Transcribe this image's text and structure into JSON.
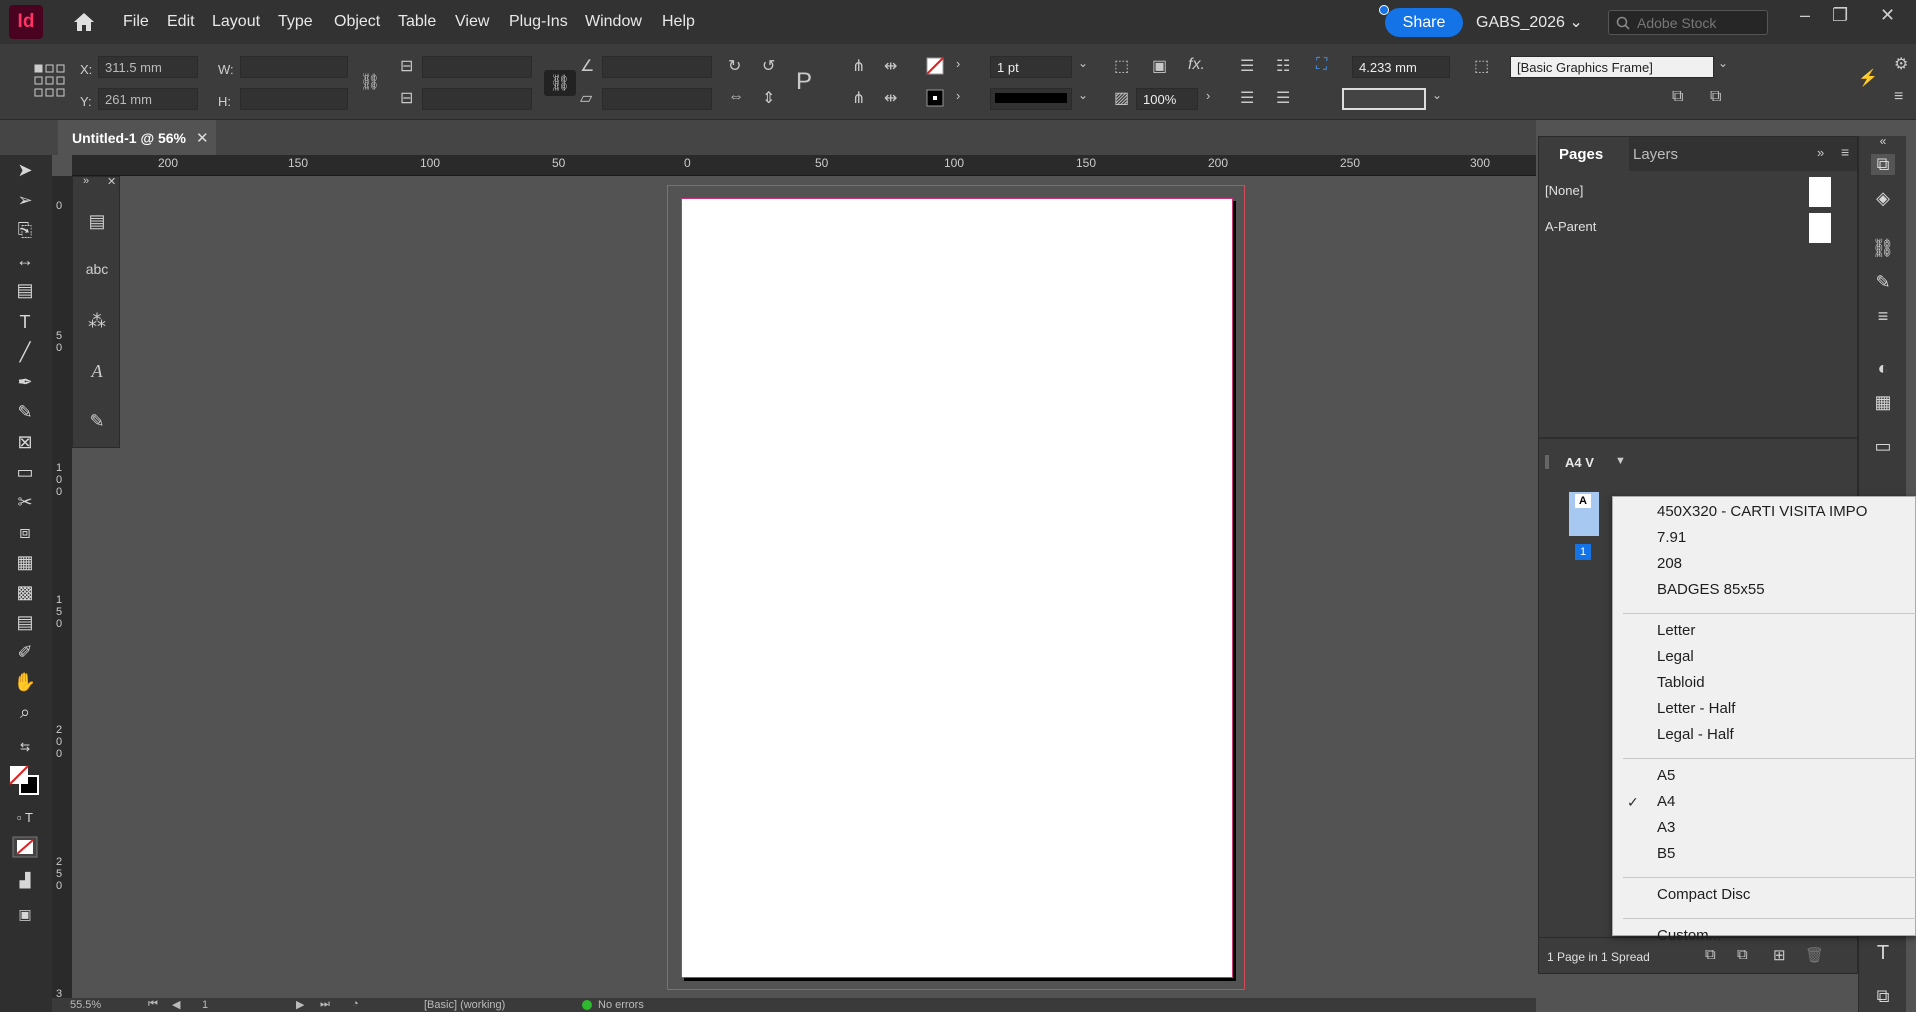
{
  "app": {
    "logo": "Id",
    "workspace": "GABS_2026",
    "share_label": "Share",
    "stock_placeholder": "Adobe Stock"
  },
  "menu": [
    "File",
    "Edit",
    "Layout",
    "Type",
    "Object",
    "Table",
    "View",
    "Plug-Ins",
    "Window",
    "Help"
  ],
  "control": {
    "x_label": "X:",
    "x_value": "311.5 mm",
    "y_label": "Y:",
    "y_value": "261 mm",
    "w_label": "W:",
    "h_label": "H:",
    "stroke_weight": "1 pt",
    "opacity": "100%",
    "spacing": "4.233 mm",
    "object_style": "[Basic Graphics Frame]"
  },
  "document": {
    "tab_title": "Untitled-1 @ 56%"
  },
  "ruler": {
    "h_ticks": [
      "200",
      "150",
      "100",
      "50",
      "0",
      "50",
      "100",
      "150",
      "200",
      "250",
      "300"
    ],
    "v_ticks": [
      "0",
      "5\n0",
      "1\n0\n0",
      "1\n5\n0",
      "2\n0\n0",
      "2\n5\n0",
      "3"
    ]
  },
  "status": {
    "zoom": "55.5%",
    "page": "1",
    "preflight_profile": "[Basic] (working)",
    "errors": "No errors"
  },
  "pages_panel": {
    "tabs": [
      "Pages",
      "Layers"
    ],
    "parents": [
      "[None]",
      "A-Parent"
    ],
    "page_size": "A4 V",
    "thumb_label": "A",
    "page_number": "1",
    "footer": "1 Page in 1 Spread"
  },
  "size_menu": {
    "groups": [
      [
        "450X320 - CARTI VISITA IMPO",
        "7.91",
        "208",
        "BADGES 85x55"
      ],
      [
        "Letter",
        "Legal",
        "Tabloid",
        "Letter - Half",
        "Legal - Half"
      ],
      [
        "A5",
        "A4",
        "A3",
        "B5"
      ],
      [
        "Compact Disc"
      ],
      [
        "Custom..."
      ]
    ],
    "selected": "A4"
  }
}
